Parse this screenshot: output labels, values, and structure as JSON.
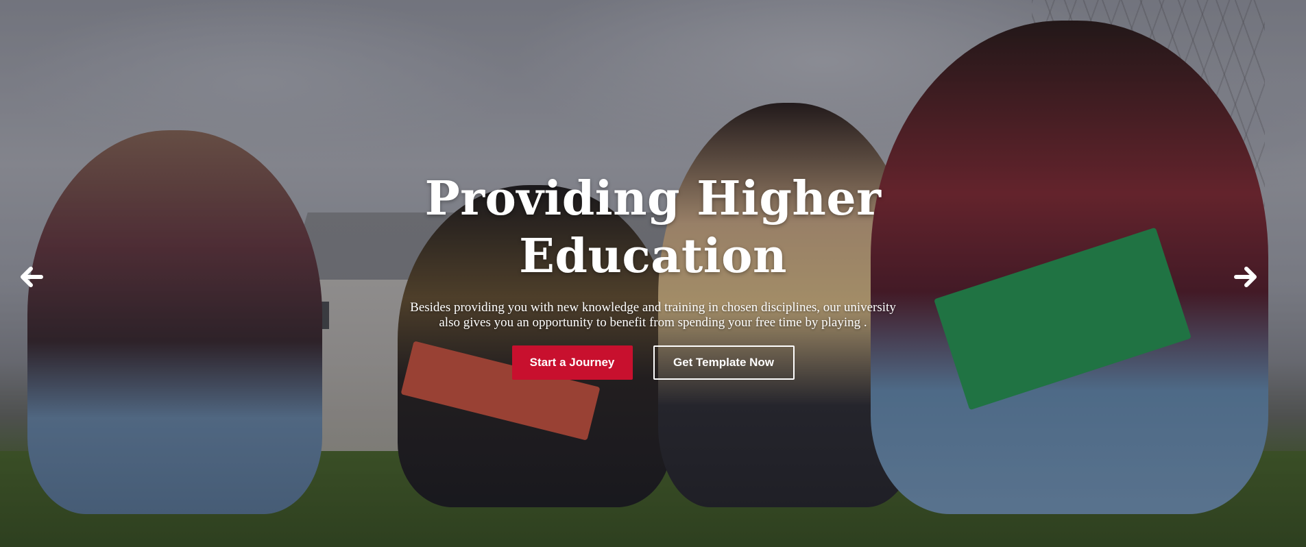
{
  "hero": {
    "title_line1": "Providing Higher",
    "title_line2": "Education",
    "subtitle_line1": "Besides providing you with new knowledge and training in chosen disciplines, our university",
    "subtitle_line2": "also gives you an opportunity to benefit from spending your free time by playing .",
    "primary_button": "Start a Journey",
    "secondary_button": "Get Template Now"
  },
  "carousel": {
    "prev_icon": "arrow-left-icon",
    "next_icon": "arrow-right-icon"
  },
  "colors": {
    "accent": "#c8102e",
    "text": "#ffffff",
    "overlay": "rgba(20,20,30,0.32)"
  }
}
